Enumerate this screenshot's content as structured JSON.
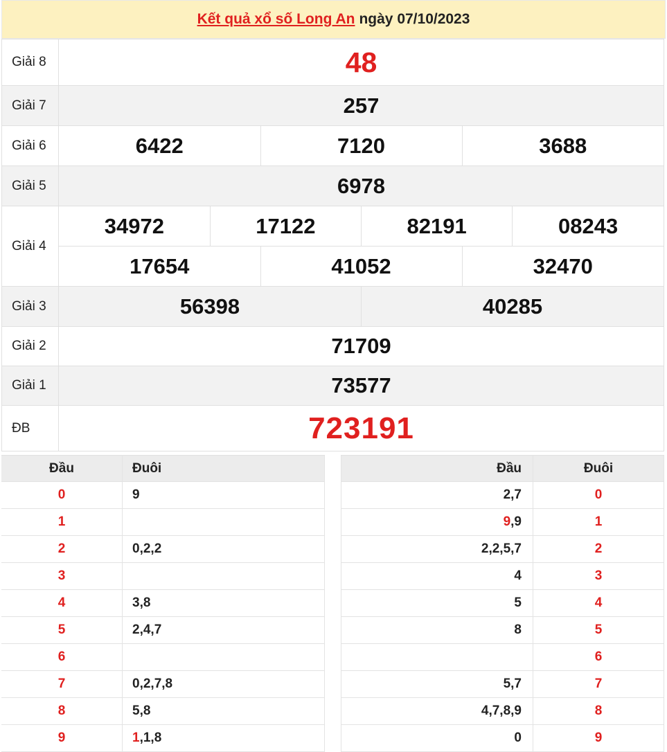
{
  "header": {
    "link": "Kết quả xổ số Long An",
    "rest": "ngày 07/10/2023"
  },
  "prizes": {
    "g8": {
      "label": "Giải 8",
      "numbers": [
        "48"
      ]
    },
    "g7": {
      "label": "Giải 7",
      "numbers": [
        "257"
      ]
    },
    "g6": {
      "label": "Giải 6",
      "numbers": [
        "6422",
        "7120",
        "3688"
      ]
    },
    "g5": {
      "label": "Giải 5",
      "numbers": [
        "6978"
      ]
    },
    "g4": {
      "label": "Giải 4",
      "numbers": [
        "34972",
        "17122",
        "82191",
        "08243",
        "17654",
        "41052",
        "32470"
      ]
    },
    "g3": {
      "label": "Giải 3",
      "numbers": [
        "56398",
        "40285"
      ]
    },
    "g2": {
      "label": "Giải 2",
      "numbers": [
        "71709"
      ]
    },
    "g1": {
      "label": "Giải 1",
      "numbers": [
        "73577"
      ]
    },
    "db": {
      "label": "ĐB",
      "numbers": [
        "723191"
      ]
    }
  },
  "dau_table": {
    "head_dau": "Đầu",
    "head_duoi": "Đuôi",
    "rows": [
      {
        "key": "0",
        "pre": "",
        "val": "9"
      },
      {
        "key": "1",
        "pre": "",
        "val": ""
      },
      {
        "key": "2",
        "pre": "",
        "val": "0,2,2"
      },
      {
        "key": "3",
        "pre": "",
        "val": ""
      },
      {
        "key": "4",
        "pre": "",
        "val": "3,8"
      },
      {
        "key": "5",
        "pre": "",
        "val": "2,4,7"
      },
      {
        "key": "6",
        "pre": "",
        "val": ""
      },
      {
        "key": "7",
        "pre": "",
        "val": "0,2,7,8"
      },
      {
        "key": "8",
        "pre": "",
        "val": "5,8"
      },
      {
        "key": "9",
        "pre": "1",
        "val": ",1,8"
      }
    ]
  },
  "duoi_table": {
    "head_dau": "Đầu",
    "head_duoi": "Đuôi",
    "rows": [
      {
        "key": "0",
        "pre": "",
        "val": "2,7"
      },
      {
        "key": "1",
        "pre": "9",
        "val": ",9"
      },
      {
        "key": "2",
        "pre": "",
        "val": "2,2,5,7"
      },
      {
        "key": "3",
        "pre": "",
        "val": "4"
      },
      {
        "key": "4",
        "pre": "",
        "val": "5"
      },
      {
        "key": "5",
        "pre": "",
        "val": "8"
      },
      {
        "key": "6",
        "pre": "",
        "val": ""
      },
      {
        "key": "7",
        "pre": "",
        "val": "5,7"
      },
      {
        "key": "8",
        "pre": "",
        "val": "4,7,8,9"
      },
      {
        "key": "9",
        "pre": "",
        "val": "0"
      }
    ]
  }
}
